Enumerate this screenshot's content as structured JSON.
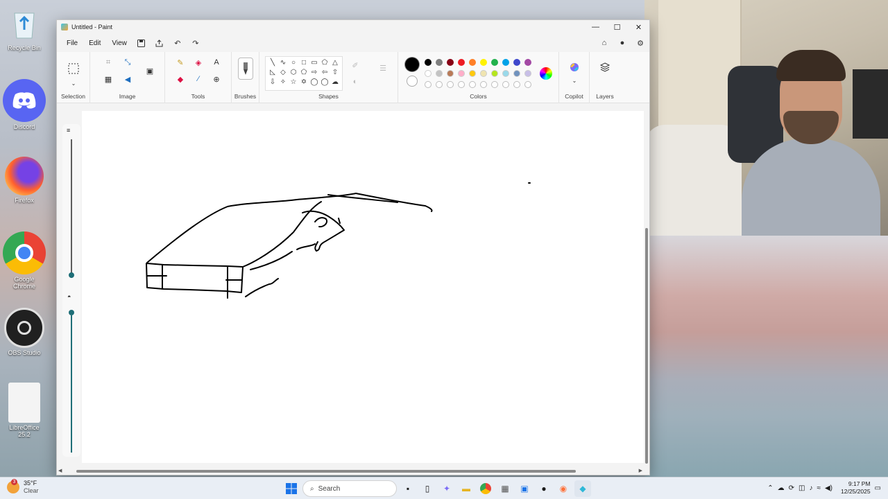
{
  "desktop": {
    "icons": [
      {
        "label": "Recycle Bin",
        "icon": "recycle-bin-icon"
      },
      {
        "label": "Discord",
        "icon": "discord-icon"
      },
      {
        "label": "Firefox",
        "icon": "firefox-icon"
      },
      {
        "label": "Google Chrome",
        "icon": "chrome-icon"
      },
      {
        "label": "OBS Studio",
        "icon": "obs-icon"
      },
      {
        "label": "LibreOffice 25.2",
        "icon": "libreoffice-icon"
      }
    ]
  },
  "window": {
    "title": "Untitled - Paint",
    "controls": {
      "minimize": "—",
      "maximize": "☐",
      "close": "✕"
    }
  },
  "menu": {
    "file": "File",
    "edit": "Edit",
    "view": "View"
  },
  "ribbon": {
    "groups": {
      "selection": "Selection",
      "image": "Image",
      "tools": "Tools",
      "brushes": "Brushes",
      "shapes": "Shapes",
      "colors": "Colors",
      "copilot": "Copilot",
      "layers": "Layers"
    },
    "shape_glyphs": [
      "╲",
      "∿",
      "○",
      "□",
      "▭",
      "⬠",
      "△",
      "◺",
      "◇",
      "⬡",
      "⬠",
      "⇨",
      "⇦",
      "⇧",
      "⇩",
      "✧",
      "☆",
      "✡",
      "◯",
      "◯",
      "☁"
    ],
    "palette_row1": [
      "#000000",
      "#7f7f7f",
      "#880015",
      "#ed1c24",
      "#ff7f27",
      "#fff200",
      "#22b14c",
      "#00a2e8",
      "#3f48cc",
      "#a349a4"
    ],
    "palette_row2": [
      "#ffffff",
      "#c3c3c3",
      "#b97a57",
      "#ffaec9",
      "#ffc90e",
      "#efe4b0",
      "#b5e61d",
      "#99d9ea",
      "#7092be",
      "#c8bfe7"
    ],
    "primary_color": "#000000",
    "secondary_color": "#ffffff"
  },
  "taskbar": {
    "weather_temp": "35°F",
    "weather_desc": "Clear",
    "weather_badge": "3",
    "search_placeholder": "Search",
    "time": "9:17 PM",
    "date": "12/25/2025"
  }
}
